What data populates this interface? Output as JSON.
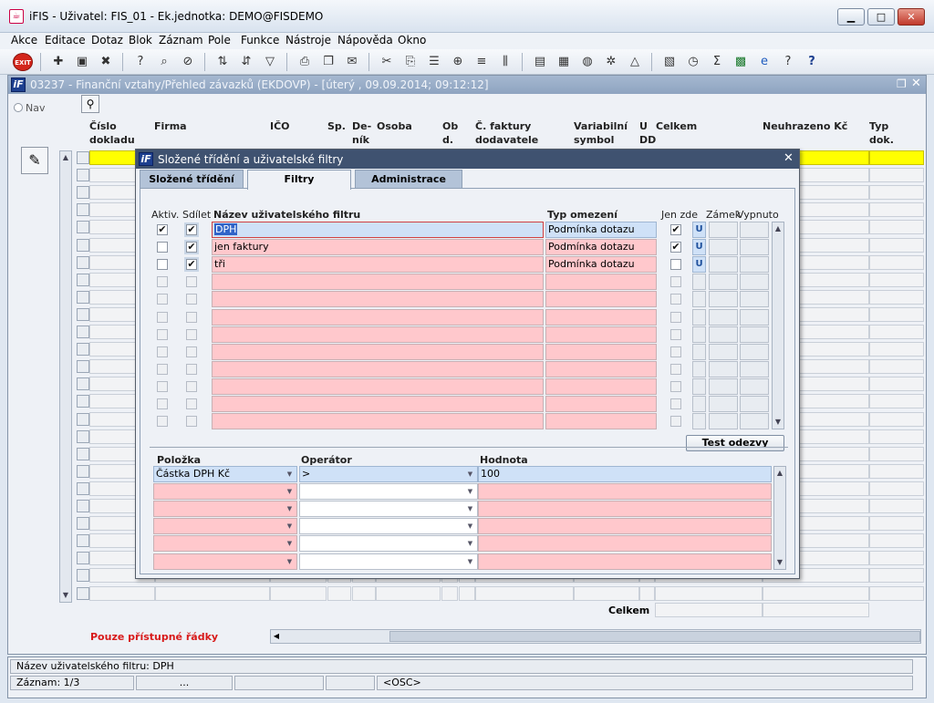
{
  "window": {
    "title": "iFIS - Uživatel: FIS_01 - Ek.jednotka: DEMO@FISDEMO",
    "minimize": "▁",
    "maximize": "□",
    "close": "✕"
  },
  "menu": [
    "Akce",
    "Editace",
    "Dotaz",
    "Blok",
    "Záznam",
    "Pole",
    "Funkce",
    "Nástroje",
    "Nápověda",
    "Okno"
  ],
  "toolbar": {
    "exit_label": "EXIT"
  },
  "form": {
    "title": "03237 - Finanční vztahy/Přehled závazků (EKDOVP) - [úterý  , 09.09.2014; 09:12:12]",
    "nav_label": "Nav",
    "columns": [
      "Číslo dokladu",
      "Firma",
      "IČO",
      "Sp.",
      "De-ník",
      "Osoba",
      "Ob d.",
      "Č. faktury dodavatele",
      "Variabilní symbol",
      "U DD",
      "Celkem",
      "Neuhrazeno Kč",
      "Typ dok."
    ],
    "total_label": "Celkem",
    "only_accessible_rows": "Pouze přístupné řádky"
  },
  "dialog": {
    "title": "Složené třídění a uživatelské filtry",
    "close": "✕",
    "tabs": [
      "Složené třídění",
      "Filtry",
      "Administrace filtrů"
    ],
    "active_tab": "Filtry",
    "filter_headers": {
      "active": "Aktiv.",
      "share": "Sdílet",
      "name": "Název uživatelského filtru",
      "type": "Typ omezení",
      "only_here": "Jen zde",
      "lock": "Zámek",
      "off": "Vypnuto"
    },
    "filters": [
      {
        "active": true,
        "share": true,
        "name": "DPH",
        "type": "Podmínka dotazu",
        "only_here": true,
        "lock": "U"
      },
      {
        "active": false,
        "share": true,
        "name": "jen faktury",
        "type": "Podmínka dotazu",
        "only_here": true,
        "lock": "U"
      },
      {
        "active": false,
        "share": true,
        "name": "tři",
        "type": "Podmínka dotazu",
        "only_here": false,
        "lock": "U"
      }
    ],
    "test_button": "Test odezvy",
    "cond_headers": {
      "item": "Položka",
      "operator": "Operátor",
      "value": "Hodnota"
    },
    "conditions": [
      {
        "item": "Částka DPH Kč",
        "operator": ">",
        "value": "100"
      }
    ]
  },
  "status": {
    "filter_name": "Název uživatelského filtru: DPH",
    "record": "Záznam: 1/3",
    "ellipsis": "...",
    "osc": "<OSC>"
  }
}
